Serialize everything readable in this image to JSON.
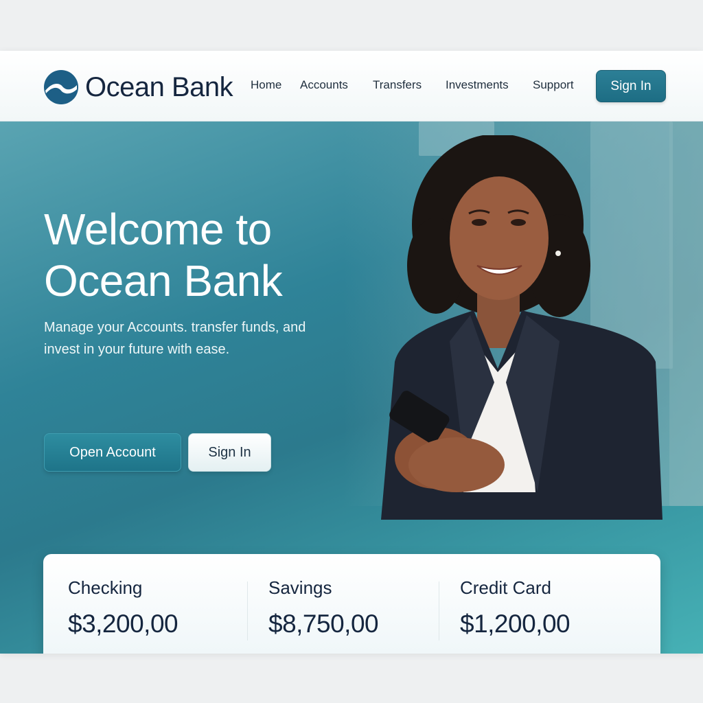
{
  "brand": {
    "name": "Ocean Bank"
  },
  "nav": {
    "items": [
      "Home",
      "Accounts",
      "Transfers",
      "Investments",
      "Support"
    ],
    "signin_label": "Sign In"
  },
  "hero": {
    "title": "Welcome to Ocean Bank",
    "subtitle": "Manage your Accounts. transfer funds, and invest in your future with ease.",
    "open_account_label": "Open Account",
    "signin_label": "Sign In"
  },
  "accounts": [
    {
      "name": "Checking",
      "balance": "$3,200,00"
    },
    {
      "name": "Savings",
      "balance": "$8,750,00"
    },
    {
      "name": "Credit Card",
      "balance": "$1,200,00"
    }
  ],
  "colors": {
    "primary": "#1d6d84",
    "navy": "#15263f",
    "hero_teal": "#2f8398"
  },
  "icons": {
    "logo": "wave-logo-icon"
  }
}
